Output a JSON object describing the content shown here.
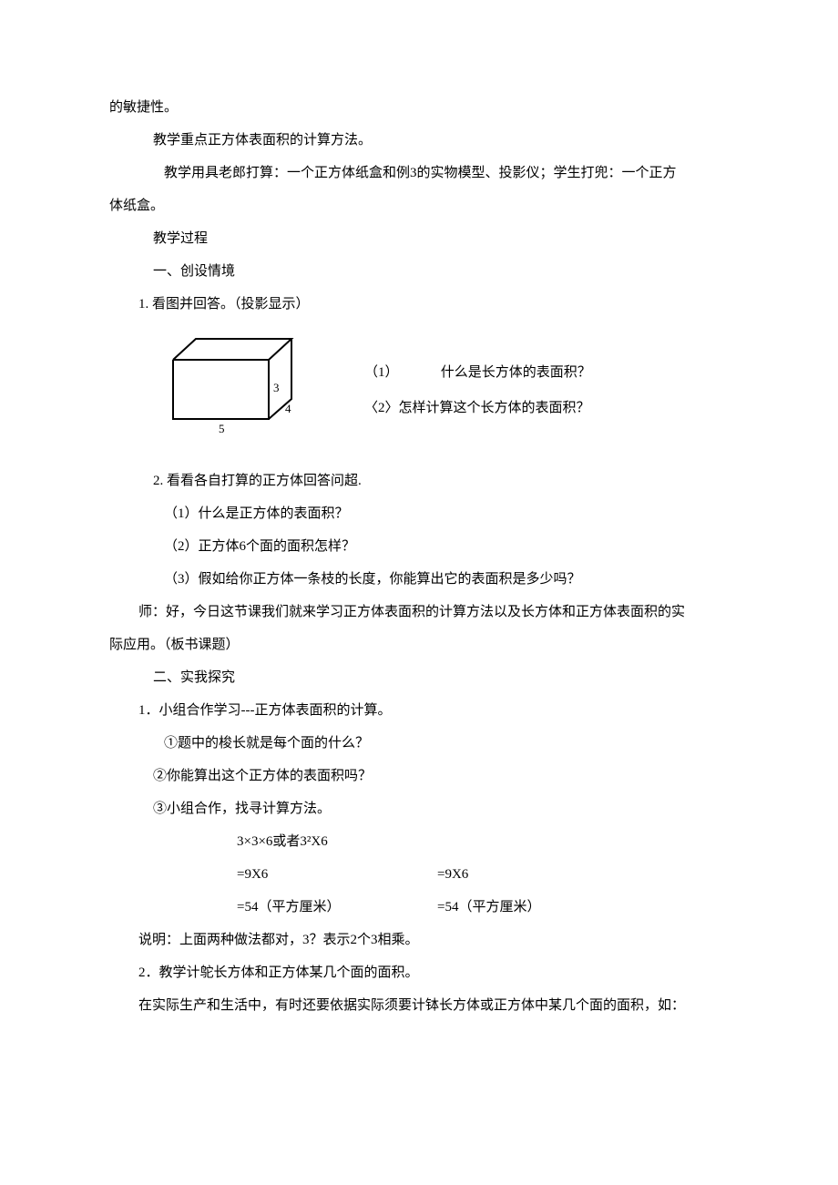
{
  "p1": "的敏捷性。",
  "p2": "教学重点正方体表面积的计算方法。",
  "p3": "教学用具老郎打算：一个正方体纸盒和例3的实物模型、投影仪；学生打兜：一个正方",
  "p3b": "体纸盒。",
  "p4": "教学过程",
  "p5": "一、创设情境",
  "p6": "1. 看图并回答。（投影显示）",
  "fig": {
    "len": "5",
    "w": "4",
    "h": "3"
  },
  "q1a": "（1）",
  "q1b": "什么是长方体的表面积？",
  "q2": "〈2〉怎样计算这个长方体的表面积？",
  "p7": "2. 看看各自打算的正方体回答问超.",
  "p8": "（1）什么是正方体的表面积？",
  "p9": "（2）正方体6个面的面积怎样？",
  "p10": "（3）假如给你正方体一条枝的长度，你能算出它的表面积是多少吗？",
  "p11a": "师：好，今日这节课我们就来学习正方体表面积的计算方法以及长方体和正方体表面积的实",
  "p11b": "际应用。（板书课题）",
  "p12": "二、实我探究",
  "p13": "1．小组合作学习---正方体表面积的计算。",
  "p14": "①题中的梭长就是每个面的什么？",
  "p15": "②你能算出这个正方体的表面积吗？",
  "p16": "③小组合作，找寻计算方法。",
  "calc": {
    "title": "3×3×6或者3²X6",
    "l1a": "=9X6",
    "l1b": "=9X6",
    "l2a": "=54（平方厘米）",
    "l2b": "=54（平方厘米）"
  },
  "p17": "说明：上面两种做法都对，3？表示2个3相乘。",
  "p18": "2．教学计鸵长方体和正方体某几个面的面积。",
  "p19": "在实际生产和生活中，有时还要依据实际须要计钵长方体或正方体中某几个面的面积，如："
}
